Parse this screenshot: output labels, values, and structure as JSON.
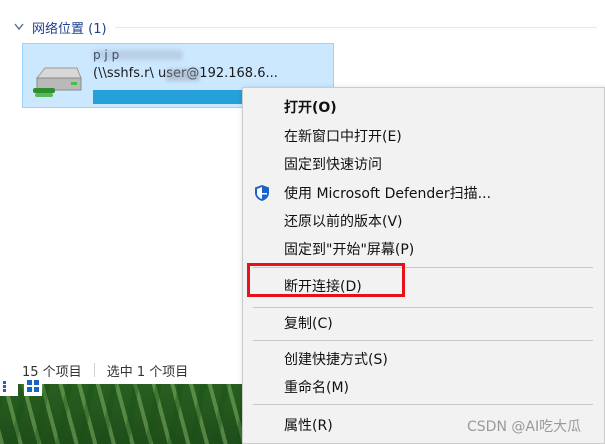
{
  "group_header": {
    "label": "网络位置 (1)"
  },
  "drive": {
    "name": "p  j   p",
    "path": "(\\\\sshfs.r\\     user@192.168.6..."
  },
  "status": {
    "item_count": "15 个项目",
    "selected": "选中 1 个项目"
  },
  "context_menu": {
    "items": [
      {
        "label": "打开(O)"
      },
      {
        "label": "在新窗口中打开(E)"
      },
      {
        "label": "固定到快速访问"
      },
      {
        "label": "使用 Microsoft Defender扫描..."
      },
      {
        "label": "还原以前的版本(V)"
      },
      {
        "label": "固定到\"开始\"屏幕(P)"
      },
      {
        "label": "断开连接(D)"
      },
      {
        "label": "复制(C)"
      },
      {
        "label": "创建快捷方式(S)"
      },
      {
        "label": "重命名(M)"
      },
      {
        "label": "属性(R)"
      }
    ]
  },
  "watermark": "CSDN @AI吃大瓜",
  "colors": {
    "selection_bg": "#cce8ff",
    "selection_border": "#99d1ff",
    "progress_fill": "#26a0da",
    "highlight_border": "#e5121a",
    "group_header_text": "#1e3f8f",
    "defender_blue": "#1a64c8"
  },
  "icons": {
    "drive": "network-drive-icon",
    "defender": "defender-shield-icon",
    "chevron": "chevron-down-icon",
    "details_view": "details-view-icon",
    "tiles_view": "tiles-view-icon"
  }
}
